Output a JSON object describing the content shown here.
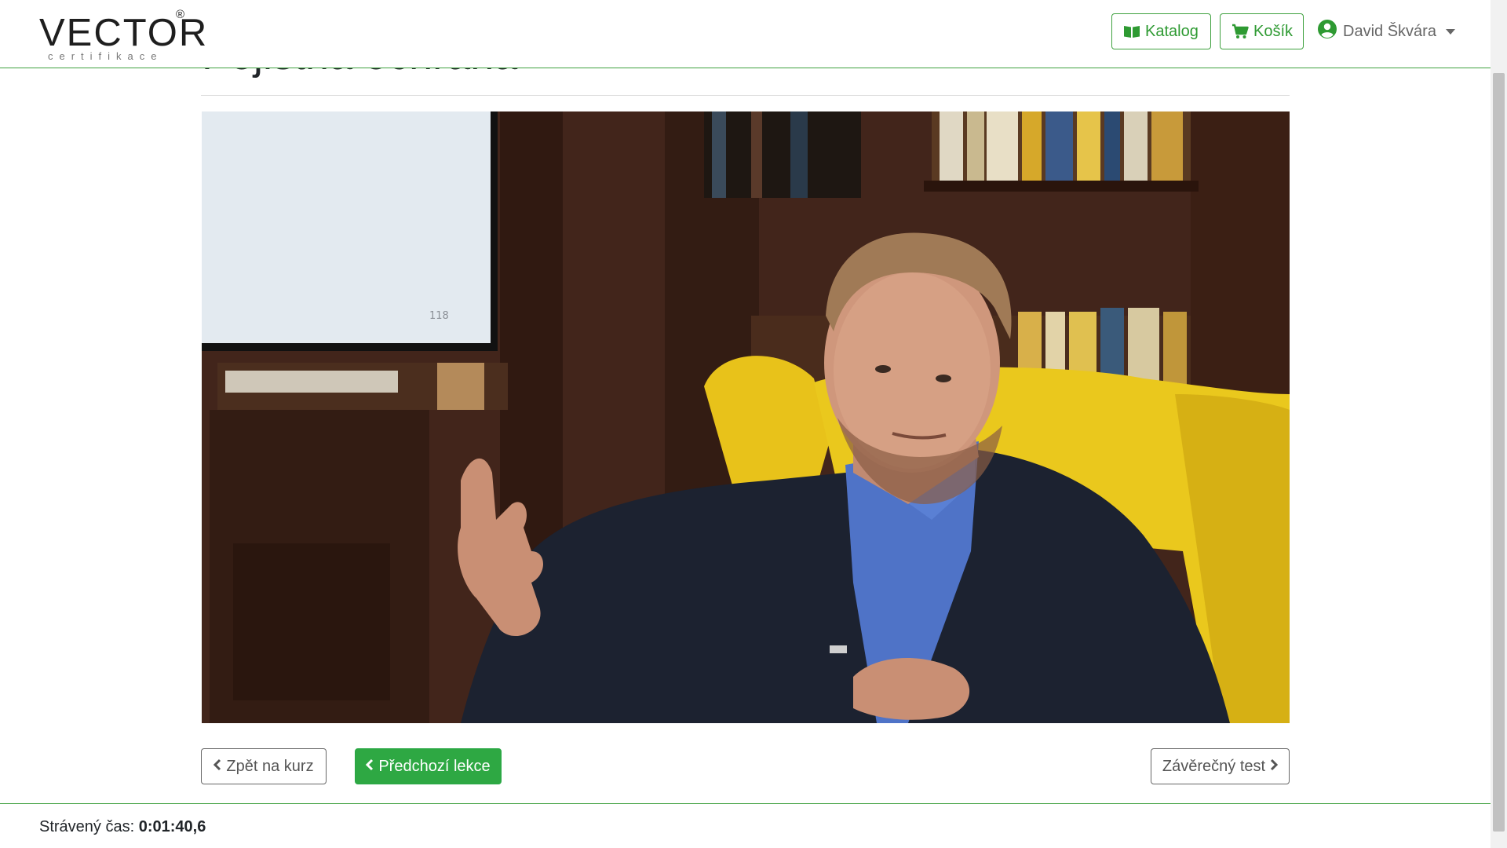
{
  "lesson": {
    "title": "Pojistná ochrana"
  },
  "navbar": {
    "logo_text": "VECTOR",
    "logo_reg": "®",
    "logo_sub": "certifikace",
    "katalog_label": "Katalog",
    "kosik_label": "Košík",
    "user_name": "David Škvára"
  },
  "video": {
    "slide_number": "118"
  },
  "buttons": {
    "back_label": "Zpět na kurz",
    "prev_label": "Předchozí lekce",
    "test_label": "Závěrečný test"
  },
  "footer": {
    "timer_label": "Strávený čas:",
    "timer_value": "0:01:40,6"
  },
  "colors": {
    "brand_green": "#2ea843",
    "navbar_border": "#3fa13f",
    "chair_yellow": "#e8c21a",
    "wood_dark": "#3a2019"
  },
  "icons": {
    "katalog": "book-open-icon",
    "kosik": "cart-icon",
    "user": "user-circle-icon",
    "prev": "chevron-left-icon",
    "next": "chevron-right-icon"
  }
}
